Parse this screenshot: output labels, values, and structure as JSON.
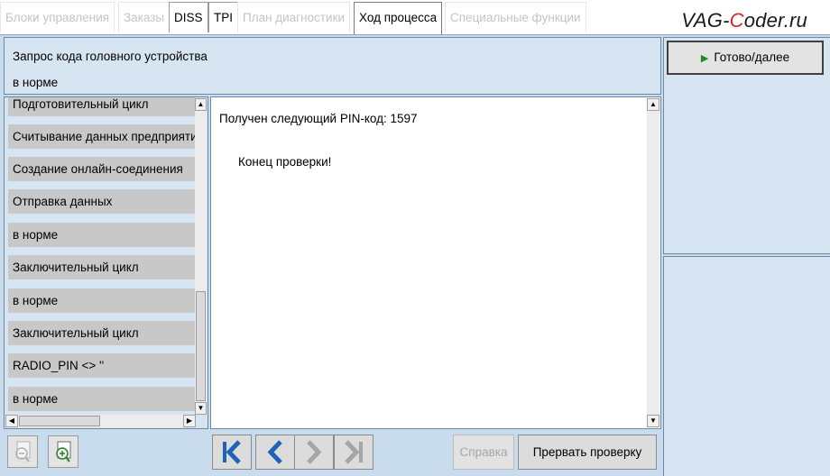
{
  "tabs": [
    {
      "label": "Блоки управления",
      "state": "disabled"
    },
    {
      "label": "Заказы",
      "state": "disabled"
    },
    {
      "label": "DISS",
      "state": "enabled"
    },
    {
      "label": "TPI",
      "state": "enabled"
    },
    {
      "label": "План диагностики",
      "state": "disabled"
    },
    {
      "label": "Ход процесса",
      "state": "active"
    },
    {
      "label": "Специальные функции",
      "state": "disabled"
    }
  ],
  "brand": {
    "prefix": "VAG-",
    "accent": "C",
    "suffix": "oder.ru"
  },
  "header": {
    "title": "Запрос кода головного устройства",
    "status": "в норме"
  },
  "steps": [
    "Подготовительный цикл",
    "Считывание данных предприятия",
    "Создание онлайн-соединения",
    "Отправка данных",
    "в норме",
    "Заключительный цикл",
    "в норме",
    "Заключительный цикл",
    "RADIO_PIN <> ''",
    "в норме"
  ],
  "main": {
    "line1": "Получен следующий PIN-код: 1597",
    "line2": "Конец проверки!"
  },
  "right": {
    "done_label": "Готово/далее"
  },
  "toolbar": {
    "help_label": "Справка",
    "abort_label": "Прервать проверку"
  },
  "icons": {
    "zoom_out": "zoom-out-icon",
    "zoom_in": "zoom-in-icon",
    "first": "skip-to-first-icon",
    "back": "back-arrow-icon",
    "forward": "forward-arrow-icon",
    "last": "skip-to-last-icon"
  },
  "colors": {
    "accent": "#d42a2a",
    "nav_icon": "#1f63b8",
    "frame_bg": "#c9dcee"
  }
}
